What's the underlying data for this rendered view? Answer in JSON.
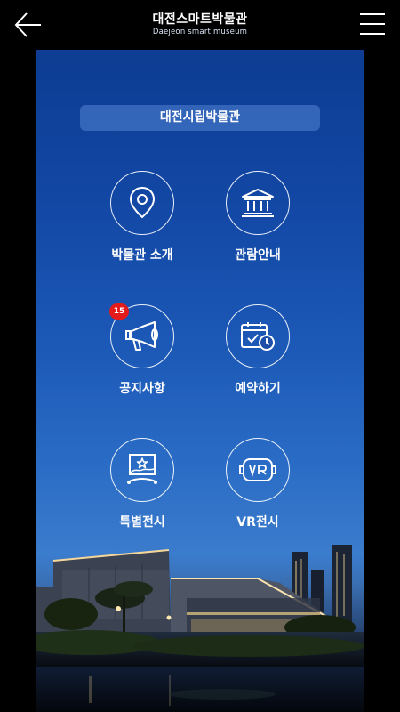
{
  "header": {
    "title": "대전스마트박물관",
    "subtitle": "Daejeon smart museum",
    "back_icon": "arrow-left-icon",
    "menu_icon": "hamburger-menu-icon"
  },
  "museum_selector": {
    "label": "대전시립박물관"
  },
  "menu": {
    "intro": {
      "label": "박물관 소개",
      "icon": "location-pin-icon"
    },
    "guide": {
      "label": "관람안내",
      "icon": "museum-building-icon"
    },
    "notice": {
      "label": "공지사항",
      "icon": "megaphone-icon",
      "badge": "15"
    },
    "reserve": {
      "label": "예약하기",
      "icon": "calendar-clock-icon"
    },
    "special": {
      "label": "특별전시",
      "icon": "exhibition-frame-icon"
    },
    "vr": {
      "label": "VR전시",
      "icon": "vr-headset-icon"
    }
  },
  "colors": {
    "accent_badge": "#e41b1b",
    "sky_top": "#0f3b8e",
    "sky_bottom": "#3b7ccd"
  }
}
